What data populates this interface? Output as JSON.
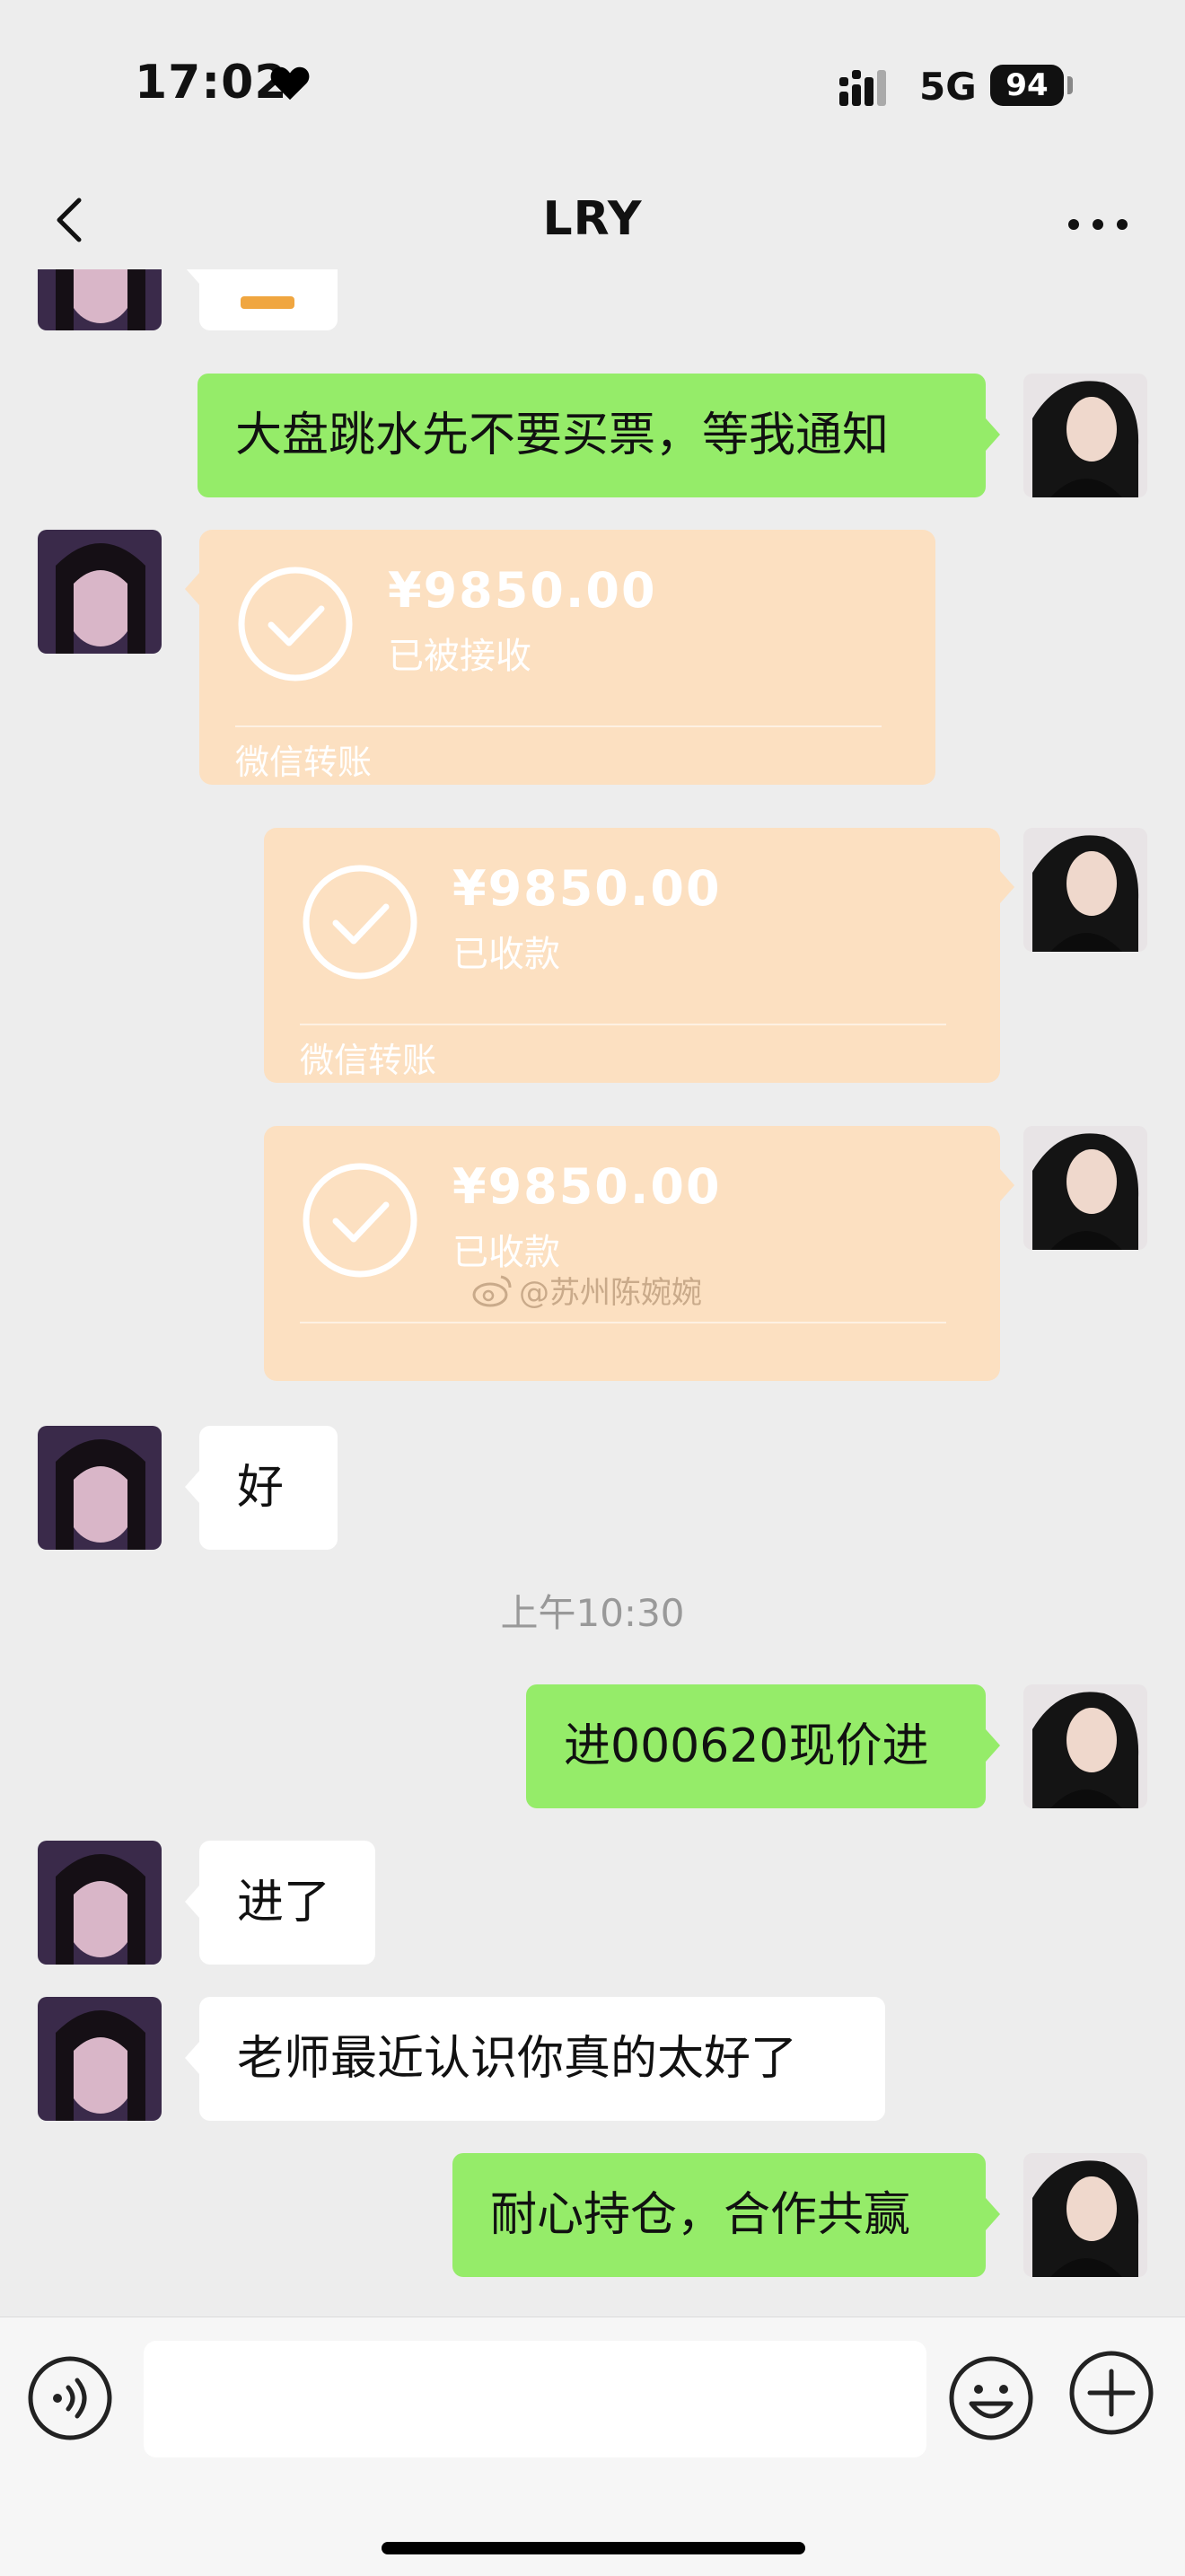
{
  "status_bar": {
    "time": "17:02",
    "network": "5G",
    "battery": "94"
  },
  "nav": {
    "title": "LRY"
  },
  "messages": {
    "m1": "大盘跳水先不要买票，等我通知",
    "t1": {
      "amount": "¥9850.00",
      "status": "已被接收",
      "label": "微信转账"
    },
    "t2": {
      "amount": "¥9850.00",
      "status": "已收款",
      "label": "微信转账"
    },
    "t3": {
      "amount": "¥9850.00",
      "status": "已收款"
    },
    "m2": "好",
    "timestamp": "上午10:30",
    "m3": "进000620现价进",
    "m4": "进了",
    "m5": "老师最近认识你真的太好了",
    "m6": "耐心持仓，合作共赢"
  },
  "watermark": "@苏州陈婉婉",
  "input": {
    "value": "",
    "placeholder": ""
  },
  "colors": {
    "self_bubble": "#95ec69",
    "other_bubble": "#ffffff",
    "transfer_bubble": "#fce0c1",
    "background": "#ededed"
  },
  "icons": [
    "heart-icon",
    "signal-icon",
    "back-arrow-icon",
    "more-icon",
    "check-icon",
    "voice-icon",
    "emoji-icon",
    "plus-icon",
    "weibo-icon"
  ]
}
